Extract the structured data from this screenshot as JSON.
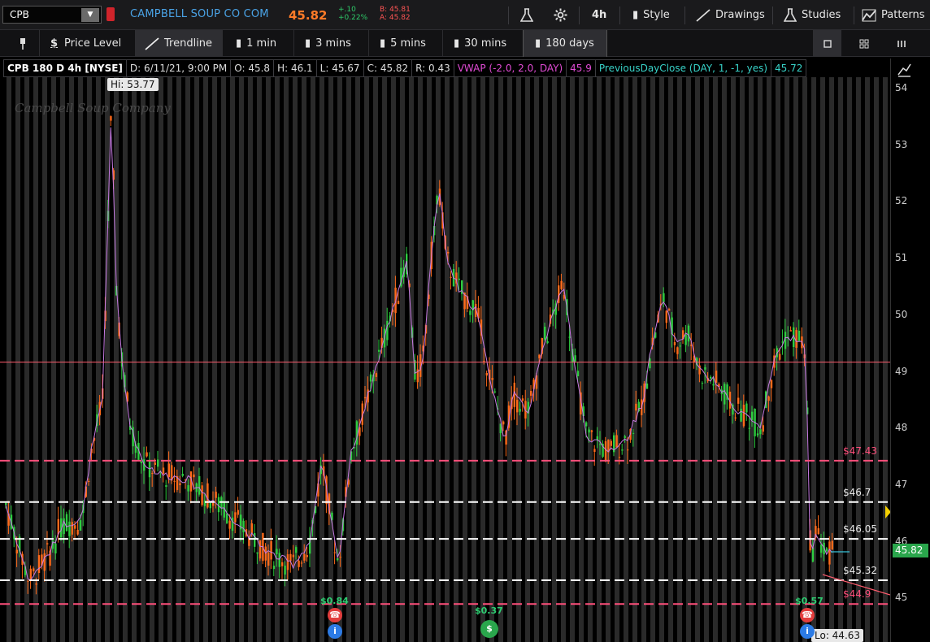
{
  "top": {
    "symbol": "CPB",
    "company": "CAMPBELL SOUP CO COM",
    "last": "45.82",
    "change": "+.10",
    "change_pct": "+0.22%",
    "bid": "B: 45.81",
    "ask": "A: 45.82",
    "aggregation": "4h",
    "style_label": "Style",
    "drawings_label": "Drawings",
    "studies_label": "Studies",
    "patterns_label": "Patterns"
  },
  "tools": {
    "price_level": "Price Level",
    "trendline": "Trendline",
    "t1": "1 min",
    "t3": "3 mins",
    "t5": "5 mins",
    "t30": "30 mins",
    "t180": "180 days"
  },
  "header": {
    "title": "CPB 180 D 4h [NYSE]",
    "date": "D: 6/11/21, 9:00 PM",
    "open": "O: 45.8",
    "high": "H: 46.1",
    "low": "L: 45.67",
    "close": "C: 45.82",
    "range": "R: 0.43",
    "vwap": "VWAP (-2.0, 2.0, DAY)",
    "vwap_value": "45.9",
    "prev_close": "PreviousDayClose (DAY, 1, -1, yes)",
    "prev_close_value": "45.72"
  },
  "chart": {
    "watermark": "Campbell Soup Company",
    "hi_label": "Hi: 53.77",
    "lo_label": "Lo: 44.63",
    "current_price": "45.82",
    "axis_ticks": [
      "54",
      "53",
      "52",
      "51",
      "50",
      "49",
      "48",
      "47",
      "46",
      "45"
    ],
    "levels": [
      {
        "label": "$47.43",
        "price": 47.43,
        "color": "#ff4f7b",
        "dash": true
      },
      {
        "label": "$46.7",
        "price": 46.7,
        "color": "#ffffff",
        "dash": true
      },
      {
        "label": "$46.05",
        "price": 46.05,
        "color": "#ffffff",
        "dash": true
      },
      {
        "label": "$45.32",
        "price": 45.32,
        "color": "#ffffff",
        "dash": true
      },
      {
        "label": "$44.9",
        "price": 44.9,
        "color": "#ff4f7b",
        "dash": true
      }
    ],
    "resistance_line": 49.17,
    "dividends": [
      {
        "label": "$0.84"
      },
      {
        "label": "$0.37"
      },
      {
        "label": "$0.57"
      }
    ],
    "colors": {
      "up": "#2ecc40",
      "down": "#ff6a1a",
      "vwap": "#c77be3",
      "grid_band": "#2a2a2a"
    }
  }
}
